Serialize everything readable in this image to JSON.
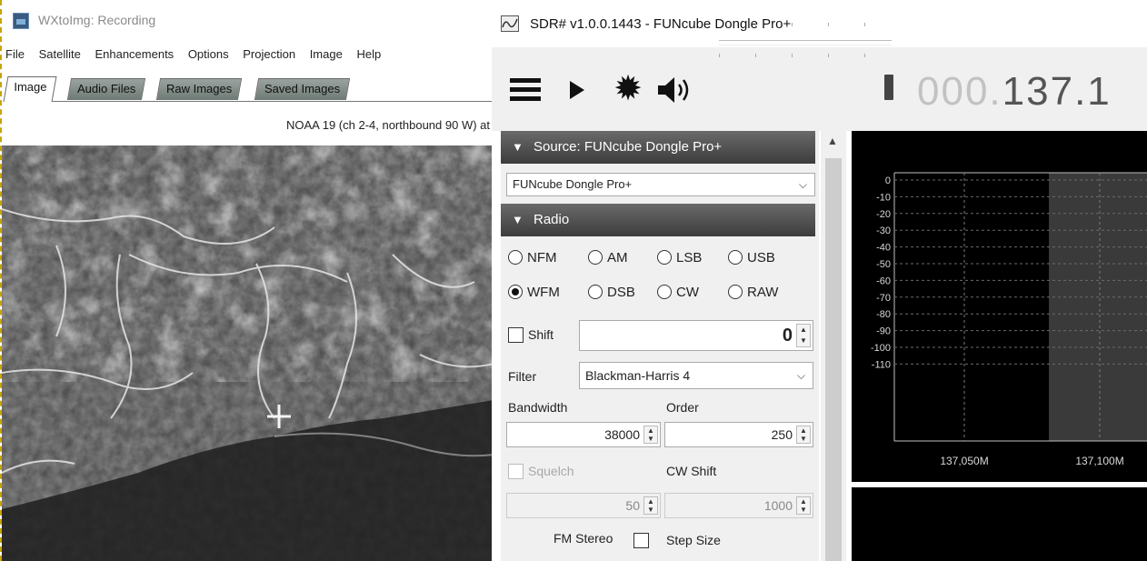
{
  "wxtoimg": {
    "title": "WXtoImg: Recording",
    "menu": [
      "File",
      "Satellite",
      "Enhancements",
      "Options",
      "Projection",
      "Image",
      "Help"
    ],
    "tabs": [
      "Image",
      "Audio Files",
      "Raw Images",
      "Saved Images"
    ],
    "active_tab": "Image",
    "satellite_info": "NOAA 19 (ch 2-4, northbound 90 W) at"
  },
  "sdr": {
    "title": "SDR# v1.0.0.1443 - FUNcube Dongle Pro+",
    "toolbar": {
      "menu_icon": "hamburger-menu-icon",
      "play_icon": "play-icon",
      "settings_icon": "gear-icon",
      "volume_icon": "speaker-icon",
      "volume_level": 1.0
    },
    "frequency": {
      "leading": "000",
      "separator": ".",
      "value": "137.1"
    },
    "source": {
      "header": "Source: FUNcube Dongle Pro+",
      "device": "FUNcube Dongle Pro+"
    },
    "radio": {
      "header": "Radio",
      "modes_row1": [
        "NFM",
        "AM",
        "LSB",
        "USB"
      ],
      "modes_row2": [
        "WFM",
        "DSB",
        "CW",
        "RAW"
      ],
      "selected_mode": "WFM",
      "shift_label": "Shift",
      "shift_value": "0",
      "filter_label": "Filter",
      "filter_value": "Blackman-Harris 4",
      "bandwidth_label": "Bandwidth",
      "bandwidth_value": "38000",
      "order_label": "Order",
      "order_value": "250",
      "squelch_label": "Squelch",
      "squelch_value": "50",
      "cw_shift_label": "CW Shift",
      "cw_shift_value": "1000",
      "fm_stereo_label": "FM Stereo",
      "step_size_label": "Step Size"
    },
    "spectrum": {
      "y_ticks": [
        "0",
        "-10",
        "-20",
        "-30",
        "-40",
        "-50",
        "-60",
        "-70",
        "-80",
        "-90",
        "-100",
        "-110"
      ],
      "x_ticks": [
        "137,050M",
        "137,100M"
      ]
    }
  }
}
